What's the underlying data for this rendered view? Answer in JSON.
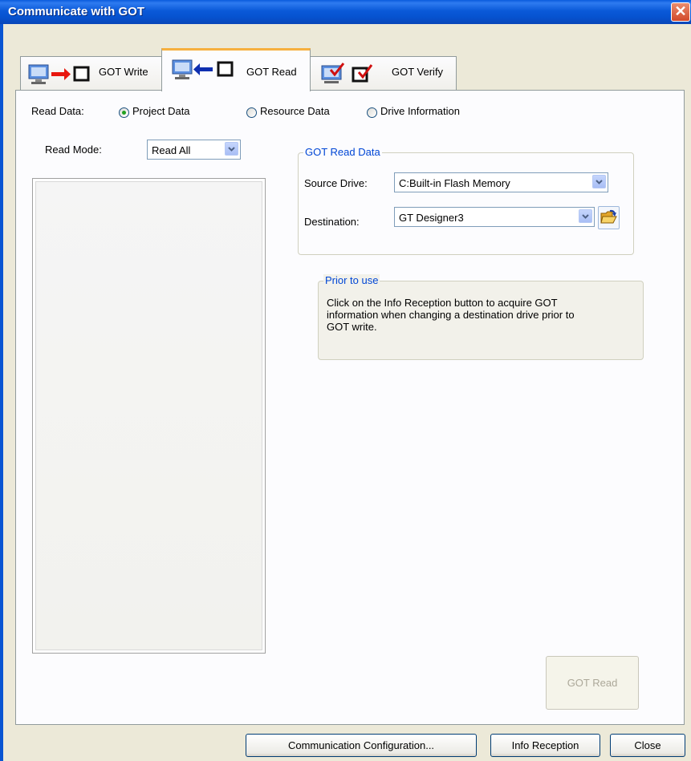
{
  "window": {
    "title": "Communicate with GOT"
  },
  "tabs": [
    {
      "label": "GOT Write",
      "icon": "pc-to-got-icon"
    },
    {
      "label": "GOT Read",
      "icon": "got-to-pc-icon"
    },
    {
      "label": "GOT Verify",
      "icon": "verify-icon"
    }
  ],
  "read_data": {
    "label": "Read Data:",
    "options": [
      {
        "label": "Project Data",
        "selected": true
      },
      {
        "label": "Resource Data",
        "selected": false
      },
      {
        "label": "Drive Information",
        "selected": false
      }
    ]
  },
  "read_mode": {
    "label": "Read Mode:",
    "value": "Read All"
  },
  "got_read_data": {
    "title": "GOT Read Data",
    "source_drive": {
      "label": "Source Drive:",
      "value": "C:Built-in Flash Memory"
    },
    "destination": {
      "label": "Destination:",
      "value": "GT Designer3"
    }
  },
  "prior": {
    "title": "Prior to use",
    "lines": [
      "Click on the Info Reception button to acquire GOT",
      "information when changing a destination drive prior to",
      "GOT write."
    ]
  },
  "buttons": {
    "got_read": "GOT Read",
    "comm_config": "Communication Configuration...",
    "info_reception": "Info Reception",
    "close": "Close"
  },
  "colors": {
    "titlebar": "#0A59D8",
    "window_bg": "#ECE9D8",
    "group_title": "#0046D5",
    "radio_dot": "#21A121"
  }
}
